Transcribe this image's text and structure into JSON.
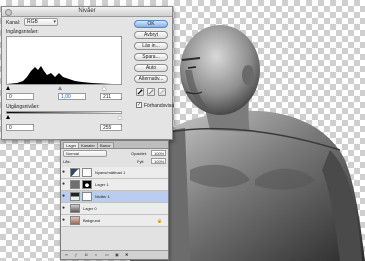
{
  "levels_dialog": {
    "title": "Nivåer",
    "channel_label": "Kanal:",
    "channel_value": "RGB",
    "input_levels_label": "Ingångsnivåer:",
    "input_black": "0",
    "input_gamma": "1,00",
    "input_white": "211",
    "output_levels_label": "Utgångsnivåer:",
    "output_black": "0",
    "output_white": "255",
    "buttons": {
      "ok": "OK",
      "cancel": "Avbryt",
      "load": "Läs in...",
      "save": "Spara...",
      "auto": "Auto",
      "options": "Alternativ..."
    },
    "preview_label": "Förhandsvisa",
    "preview_checked": true
  },
  "layers_panel": {
    "tabs": [
      "Lager",
      "Kanaler",
      "Banor"
    ],
    "blend_mode": "Normal",
    "opacity_label": "Opacitet:",
    "opacity_value": "100%",
    "lock_label": "Lås:",
    "fill_label": "Fyll:",
    "fill_value": "100%",
    "layers": [
      {
        "name": "Nyans/mättnad 1",
        "type": "adjustment",
        "visible": true,
        "selected": false
      },
      {
        "name": "Lager 1",
        "type": "pixel",
        "visible": true,
        "selected": false
      },
      {
        "name": "Nivåer 1",
        "type": "adjustment",
        "visible": true,
        "selected": true
      },
      {
        "name": "Lager 0",
        "type": "pixel",
        "visible": true,
        "selected": false
      },
      {
        "name": "Bakgrund",
        "type": "background",
        "visible": true,
        "selected": false
      }
    ]
  }
}
